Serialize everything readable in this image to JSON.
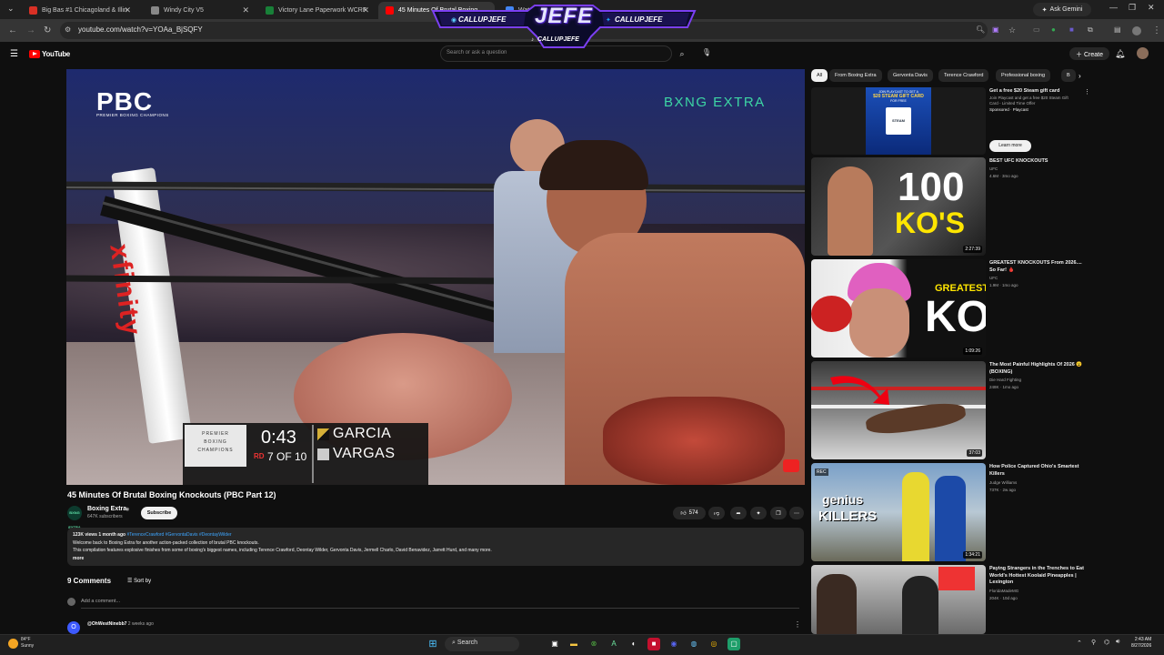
{
  "browser": {
    "tabs": [
      {
        "title": "Big Bas #1 Chicagoland & Illin",
        "color": "#d93025"
      },
      {
        "title": "Windy City V5",
        "color": "#888888"
      },
      {
        "title": "Victory Lane Paperwork WCRF",
        "color": "#188038"
      },
      {
        "title": "45 Minutes Of Brutal Boxing",
        "color": "#ff0000"
      },
      {
        "title": "Watch se",
        "color": "#4285f4"
      }
    ],
    "ask_gemini": "Ask Gemini",
    "url": "youtube.com/watch?v=YOAa_BjSQFY"
  },
  "overlay": {
    "logo": "JEFE",
    "handle_left": "CALLUPJEFE",
    "handle_right": "CALLUPJEFE",
    "handle_center": "CALLUPJEFE"
  },
  "youtube": {
    "logo": "YouTube",
    "search_placeholder": "Search or ask a question",
    "create_label": "Create"
  },
  "video": {
    "pbc_logo": "PBC",
    "pbc_sub": "PREMIER BOXING CHAMPIONS",
    "watermark": "BXNG EXTRA",
    "score_time": "0:43",
    "score_round_rd": "RD",
    "score_round": "7 OF 10",
    "fighter1": "GARCIA",
    "fighter2": "VARGAS",
    "score_logo_top": "PREMIER",
    "score_logo_mid": "BOXING",
    "score_logo_bot": "CHAMPIONS"
  },
  "watch": {
    "title": "45 Minutes Of Brutal Boxing Knockouts (PBC Part 12)",
    "channel": "Boxing Extra",
    "channel_avatar": "BXNG EXTRA",
    "subscribers": "647K subscribers",
    "subscribe": "Subscribe",
    "likes": "574",
    "desc_meta": "123K views  1 month ago",
    "desc_tags": "#TerenceCrawford #GervontaDavis #DeontayWilder",
    "desc_line1": "Welcome back to Boxing Extra for another action-packed collection of brutal PBC knockouts.",
    "desc_line2": "This compilation features explosive finishes from some of boxing's biggest names, including Terence Crawford, Deontay Wilder, Gervonta Davis, Jermell Charlo, David Benavidez, Jarrett Hurd, and many more.",
    "desc_more": "more",
    "comments_count": "9 Comments",
    "sort_by": "Sort by",
    "add_comment": "Add a comment...",
    "comment_user": "@OhWestNinebb7",
    "comment_time": "2 weeks ago",
    "comment_initial": "O"
  },
  "chips": [
    "All",
    "From Boxing Extra",
    "Gervonta Davis",
    "Terence Crawford",
    "Professional boxing",
    "B"
  ],
  "ad": {
    "title": "Get a free $20 Steam gift card",
    "line1": "Join Playcast and get a free $20 Steam Gift",
    "line2": "Card - Limited Time Offer",
    "sponsor": "Sponsored · Playcast",
    "learn_more": "Learn more",
    "thumb_text1": "JOIN PLAYCAST TO GET A",
    "thumb_text2": "$20 STEAM GIFT CARD",
    "thumb_text3": "FOR FREE",
    "thumb_steam": "STEAM"
  },
  "recs": [
    {
      "title": "BEST UFC KNOCKOUTS",
      "channel": "UFC",
      "meta": "4.6M · 3mo ago",
      "duration": "2:27:39",
      "big1": "100",
      "big2": "KO'S"
    },
    {
      "title": "GREATEST KNOCKOUTS From 2026.... So Far! 🩸",
      "channel": "UFC",
      "meta": "1.9M · 1mo ago",
      "duration": "1:09:26",
      "big1": "GREATEST",
      "big2": "KO"
    },
    {
      "title": "The Most Painful Highlights Of 2026 😮 (BOXING)",
      "channel": "Die Hard Fighting",
      "meta": "248K · 1mo ago",
      "duration": "37:03"
    },
    {
      "title": "How Police Captured Ohio's Smartest Killers",
      "channel": "Judge Williams",
      "meta": "737K · 2w ago",
      "duration": "1:34:21",
      "big1": "genius",
      "big2": "KILLERS",
      "rec": "REC"
    },
    {
      "title": "Paying Strangers in the Trenches to Eat World's Hottest Koolaid Pineapples | Lexington",
      "channel": "FloridaMadeMG",
      "meta": "204K · 10d ago"
    }
  ],
  "taskbar": {
    "temp": "84°F",
    "weather": "Sunny",
    "search": "Search",
    "time": "2:43 AM",
    "date": "8/27/2026"
  }
}
